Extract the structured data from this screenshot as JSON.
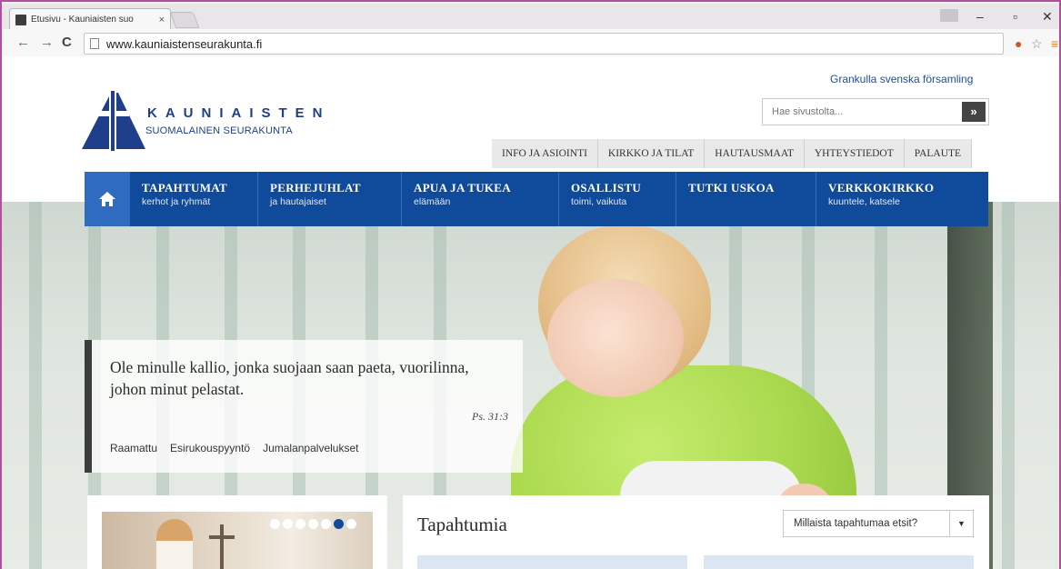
{
  "browser": {
    "tab_title": "Etusivu - Kauniaisten suo",
    "tab_close": "×",
    "url": "www.kauniaistenseurakunta.fi",
    "minimize": "–",
    "restore": "▫",
    "close": "✕"
  },
  "header": {
    "swedish_link": "Grankulla svenska församling",
    "search_placeholder": "Hae sivustolta...",
    "search_button": "»",
    "logo_title": "KAUNIAISTEN",
    "logo_subtitle": "SUOMALAINEN SEURAKUNTA",
    "utility_nav": [
      "INFO JA ASIOINTI",
      "KIRKKO JA TILAT",
      "HAUTAUSMAAT",
      "YHTEYSTIEDOT",
      "PALAUTE"
    ]
  },
  "main_nav": [
    {
      "title": "TAPAHTUMAT",
      "sub": "kerhot ja ryhmät"
    },
    {
      "title": "PERHEJUHLAT",
      "sub": "ja hautajaiset"
    },
    {
      "title": "APUA JA TUKEA",
      "sub": "elämään"
    },
    {
      "title": "OSALLISTU",
      "sub": "toimi, vaikuta"
    },
    {
      "title": "TUTKI USKOA",
      "sub": ""
    },
    {
      "title": "VERKKOKIRKKO",
      "sub": "kuuntele, katsele"
    }
  ],
  "hero": {
    "quote": "Ole minulle kallio, jonka suojaan saan paeta, vuorilinna, johon minut pelastat.",
    "reference": "Ps. 31:3",
    "links": [
      "Raamattu",
      "Esirukouspyyntö",
      "Jumalanpalvelukset"
    ]
  },
  "carousel": {
    "slide_count": 6,
    "active_index": 5
  },
  "events": {
    "title": "Tapahtumia",
    "select_label": "Millaista tapahtumaa etsit?",
    "select_caret": "▼"
  },
  "colors": {
    "brand_blue": "#0f4b9a",
    "home_blue": "#2f6cc0",
    "window_border": "#b24f9c"
  }
}
